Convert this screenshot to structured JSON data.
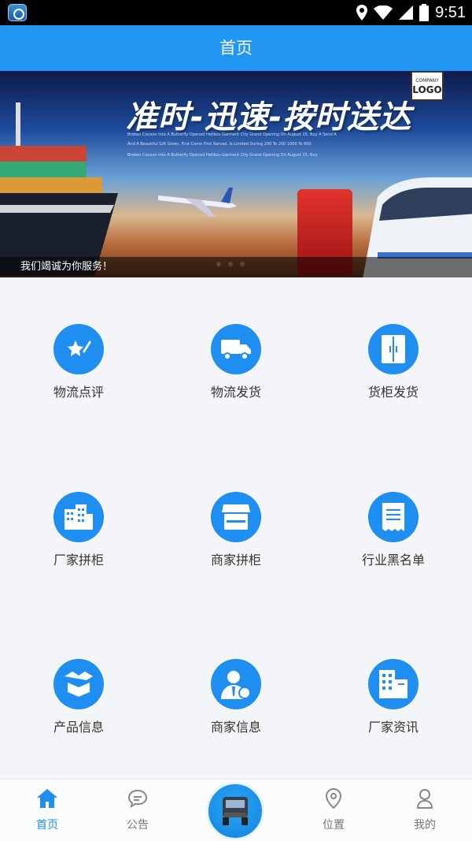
{
  "status_bar": {
    "time": "9:51"
  },
  "header": {
    "title": "首页"
  },
  "banner": {
    "headline": "准时-迅速-按时送达",
    "logo_top": "COMPANY",
    "logo_bottom": "LOGO",
    "small_lines": [
      "Broken Cocoon Into A Butterfly Opened Heilkou Garment City Grand Opening On August 15, Buy A Send A",
      "And A Beautiful Gift Given, First Come First Served, Is Limited During 200 To 200 1000 To 800",
      "Broken Cocoon Into A Butterfly Opened Heilkou Garment City Grand Opening On August 15, Buy"
    ],
    "caption": "我们竭诚为你服务！"
  },
  "grid": [
    {
      "label": "物流点评",
      "icon": "review-star-pen-icon"
    },
    {
      "label": "物流发货",
      "icon": "delivery-truck-icon"
    },
    {
      "label": "货柜发货",
      "icon": "container-cabinet-icon"
    },
    {
      "label": "厂家拼柜",
      "icon": "factory-buildings-icon"
    },
    {
      "label": "商家拼柜",
      "icon": "shop-store-icon"
    },
    {
      "label": "行业黑名单",
      "icon": "receipt-list-icon"
    },
    {
      "label": "产品信息",
      "icon": "box-package-icon"
    },
    {
      "label": "商家信息",
      "icon": "business-person-icon"
    },
    {
      "label": "厂家资讯",
      "icon": "office-building-icon"
    }
  ],
  "tabbar": {
    "tabs": [
      {
        "label": "首页",
        "icon": "home-icon",
        "active": true
      },
      {
        "label": "公告",
        "icon": "message-bubble-icon",
        "active": false
      },
      {
        "label": "位置",
        "icon": "location-pin-icon",
        "active": false
      },
      {
        "label": "我的",
        "icon": "user-profile-icon",
        "active": false
      }
    ],
    "center_icon": "truck-front-icon"
  },
  "colors": {
    "primary": "#2196f3",
    "icon_circle": "#1f8ef1",
    "background": "#f3f5f8"
  }
}
